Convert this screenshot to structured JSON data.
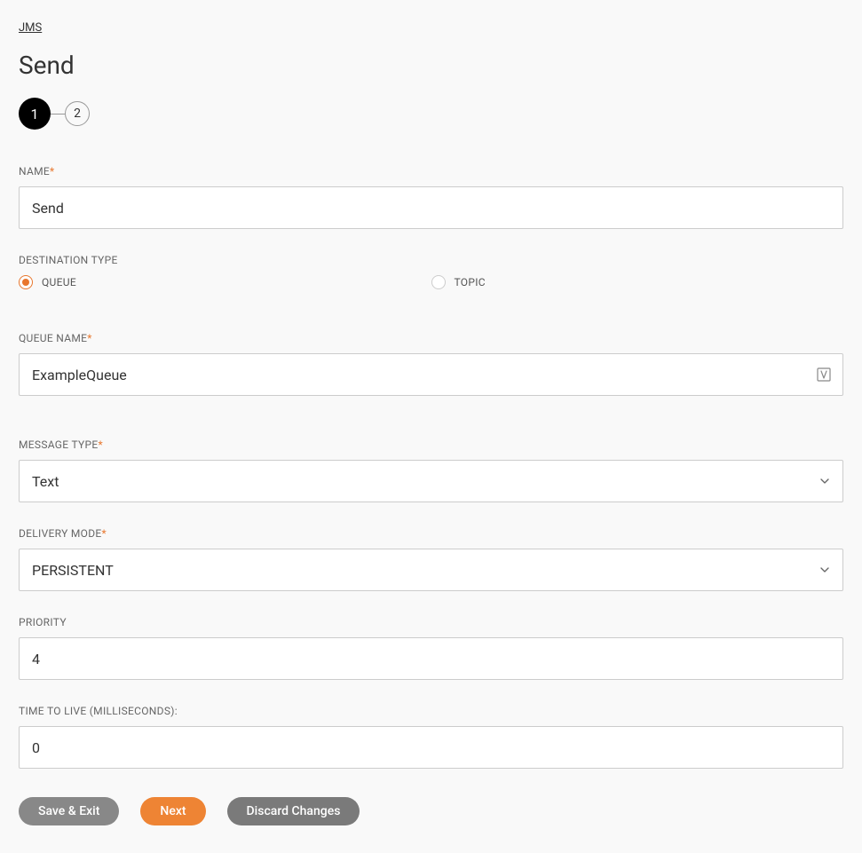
{
  "breadcrumb": "JMS",
  "pageTitle": "Send",
  "stepper": {
    "step1": "1",
    "step2": "2"
  },
  "fields": {
    "name": {
      "label": "NAME",
      "value": "Send",
      "required": true
    },
    "destinationType": {
      "label": "DESTINATION TYPE",
      "options": {
        "queue": "QUEUE",
        "topic": "TOPIC"
      },
      "selected": "queue"
    },
    "queueName": {
      "label": "QUEUE NAME",
      "value": "ExampleQueue",
      "required": true
    },
    "messageType": {
      "label": "MESSAGE TYPE",
      "value": "Text",
      "required": true
    },
    "deliveryMode": {
      "label": "DELIVERY MODE",
      "value": "PERSISTENT",
      "required": true
    },
    "priority": {
      "label": "PRIORITY",
      "value": "4"
    },
    "ttl": {
      "label": "TIME TO LIVE (MILLISECONDS):",
      "value": "0"
    }
  },
  "buttons": {
    "saveExit": "Save & Exit",
    "next": "Next",
    "discard": "Discard Changes"
  },
  "requiredMark": "*"
}
